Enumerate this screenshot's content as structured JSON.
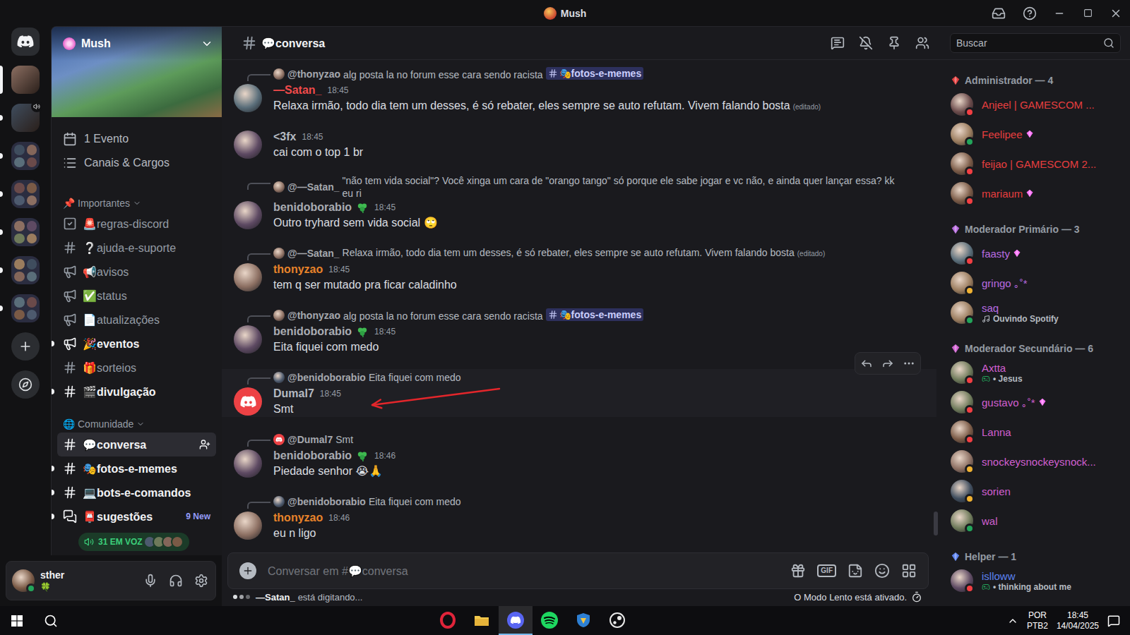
{
  "window": {
    "title": "Mush"
  },
  "servers": [
    {
      "kind": "server",
      "selected": true,
      "unread": false,
      "voice": false
    },
    {
      "kind": "server",
      "selected": false,
      "unread": true,
      "voice": true
    },
    {
      "kind": "folder",
      "selected": false,
      "unread": true,
      "voice": false
    },
    {
      "kind": "folder",
      "selected": false,
      "unread": true,
      "voice": false
    },
    {
      "kind": "folder",
      "selected": false,
      "unread": true,
      "voice": false
    },
    {
      "kind": "folder",
      "selected": false,
      "unread": true,
      "voice": false
    },
    {
      "kind": "folder",
      "selected": false,
      "unread": true,
      "voice": false
    }
  ],
  "server": {
    "name": "Mush",
    "events": "1 Evento",
    "browse": "Canais & Cargos"
  },
  "categories": [
    {
      "emoji": "📌",
      "name": "Importantes",
      "expanded": true,
      "channels": [
        {
          "kind": "rules",
          "name": "🚨regras-discord",
          "selected": false,
          "unread": false,
          "badge": ""
        },
        {
          "kind": "text",
          "name": "❔ajuda-e-suporte",
          "selected": false,
          "unread": false,
          "badge": ""
        },
        {
          "kind": "announcement",
          "name": "📢avisos",
          "selected": false,
          "unread": false,
          "badge": ""
        },
        {
          "kind": "announcement",
          "name": "✅status",
          "selected": false,
          "unread": false,
          "badge": ""
        },
        {
          "kind": "announcement",
          "name": "📄atualizações",
          "selected": false,
          "unread": false,
          "badge": ""
        },
        {
          "kind": "announcement",
          "name": "🎉eventos",
          "selected": false,
          "unread": true,
          "badge": ""
        },
        {
          "kind": "text",
          "name": "🎁sorteios",
          "selected": false,
          "unread": false,
          "badge": ""
        },
        {
          "kind": "text",
          "name": "🎬divulgação",
          "selected": false,
          "unread": true,
          "badge": ""
        }
      ]
    },
    {
      "emoji": "🌐",
      "name": "Comunidade",
      "expanded": true,
      "channels": [
        {
          "kind": "text",
          "name": "💬conversa",
          "selected": true,
          "unread": false,
          "badge": ""
        },
        {
          "kind": "text",
          "name": "🎭fotos-e-memes",
          "selected": false,
          "unread": true,
          "badge": ""
        },
        {
          "kind": "text",
          "name": "💻bots-e-comandos",
          "selected": false,
          "unread": true,
          "badge": ""
        },
        {
          "kind": "forum",
          "name": "📮sugestões",
          "selected": false,
          "unread": true,
          "badge": "9 New"
        }
      ]
    }
  ],
  "voice": {
    "label": "31 EM VOZ",
    "avatars": 4
  },
  "user": {
    "name": "sther",
    "status": "online",
    "custom_status": "🍀"
  },
  "channel": {
    "name": "💬conversa"
  },
  "search": {
    "placeholder": "Buscar"
  },
  "messages": [
    {
      "author": "—Satan_",
      "color": "#f04a4a",
      "avatar": "photo",
      "role_icon": false,
      "time": "18:45",
      "content": "Relaxa irmão, todo dia tem um desses, é só rebater, eles sempre se auto refutam. Vivem falando bosta",
      "edited": "(editado)",
      "hovered": false,
      "marked": false,
      "reply": {
        "author": "@thonyzao",
        "avatar": "photo",
        "text": "alg posta la no forum esse cara sendo racista",
        "mention": "🎭fotos-e-memes",
        "edited": ""
      }
    },
    {
      "author": "<3fx",
      "color": "#b5bac1",
      "avatar": "photo",
      "role_icon": false,
      "time": "18:45",
      "content": "cai com o top 1 br",
      "edited": "",
      "hovered": false,
      "marked": false,
      "reply": null
    },
    {
      "author": "benidoborabio",
      "color": "#a9acb2",
      "avatar": "photo",
      "role_icon": true,
      "time": "18:45",
      "content": "Outro tryhard sem vida social 🙄",
      "edited": "",
      "hovered": false,
      "marked": false,
      "reply": {
        "author": "@—Satan_",
        "avatar": "photo",
        "text": "\"não tem vida social\"? Você xinga um cara de \"orango tango\" só porque ele sabe jogar e vc não, e ainda quer lançar essa? kk eu ri",
        "mention": "",
        "edited": ""
      }
    },
    {
      "author": "thonyzao",
      "color": "#e8832a",
      "avatar": "photo",
      "role_icon": false,
      "time": "18:45",
      "content": "tem q ser mutado pra ficar caladinho",
      "edited": "",
      "hovered": false,
      "marked": false,
      "reply": {
        "author": "@—Satan_",
        "avatar": "photo",
        "text": "Relaxa irmão, todo dia tem um desses, é só rebater, eles sempre se auto refutam. Vivem falando bosta",
        "mention": "",
        "edited": "(editado)"
      }
    },
    {
      "author": "benidoborabio",
      "color": "#a9acb2",
      "avatar": "photo",
      "role_icon": true,
      "time": "18:45",
      "content": "Eita fiquei com medo",
      "edited": "",
      "hovered": false,
      "marked": false,
      "reply": {
        "author": "@thonyzao",
        "avatar": "photo",
        "text": "alg posta la no forum esse cara sendo racista",
        "mention": "🎭fotos-e-memes",
        "edited": ""
      }
    },
    {
      "author": "Dumal7",
      "color": "#b5bac1",
      "avatar": "default",
      "role_icon": false,
      "time": "18:45",
      "content": "Smt",
      "edited": "",
      "hovered": true,
      "marked": true,
      "reply": {
        "author": "@benidoborabio",
        "avatar": "photo",
        "text": "Eita fiquei com medo",
        "mention": "",
        "edited": ""
      }
    },
    {
      "author": "benidoborabio",
      "color": "#a9acb2",
      "avatar": "photo",
      "role_icon": true,
      "time": "18:46",
      "content": "Piedade senhor 😭🙏",
      "edited": "",
      "hovered": false,
      "marked": false,
      "reply": {
        "author": "@Dumal7",
        "avatar": "default",
        "text": "Smt",
        "mention": "",
        "edited": ""
      }
    },
    {
      "author": "thonyzao",
      "color": "#e8832a",
      "avatar": "photo",
      "role_icon": false,
      "time": "18:46",
      "content": "eu n ligo",
      "edited": "",
      "hovered": false,
      "marked": false,
      "reply": {
        "author": "@benidoborabio",
        "avatar": "photo",
        "text": "Eita fiquei com medo",
        "mention": "",
        "edited": ""
      }
    }
  ],
  "composer": {
    "placeholder": "Conversar em #💬conversa",
    "gif": "GIF"
  },
  "typing": {
    "name": "—Satan_",
    "text": "está digitando..."
  },
  "slow_mode": "O Modo Lento está ativado.",
  "member_groups": [
    {
      "name": "Administrador — 4",
      "color": "#e53e3e",
      "members": [
        {
          "name": "Anjeel | GAMESCOM ...",
          "status": "dnd",
          "badge": false,
          "activity": "",
          "activity_kind": ""
        },
        {
          "name": "Feelipee",
          "status": "online",
          "badge": true,
          "activity": "",
          "activity_kind": ""
        },
        {
          "name": "feijao | GAMESCOM 2...",
          "status": "dnd",
          "badge": false,
          "activity": "",
          "activity_kind": ""
        },
        {
          "name": "mariaum",
          "status": "dnd",
          "badge": true,
          "activity": "",
          "activity_kind": ""
        }
      ]
    },
    {
      "name": "Moderador Primário — 3",
      "color": "#b86be0",
      "members": [
        {
          "name": "faasty",
          "status": "dnd",
          "badge": true,
          "activity": "",
          "activity_kind": ""
        },
        {
          "name": "gringo ｡˚*",
          "status": "idle",
          "badge": false,
          "activity": "",
          "activity_kind": ""
        },
        {
          "name": "saq",
          "status": "online",
          "badge": false,
          "activity": "Ouvindo Spotify",
          "activity_kind": "listening"
        }
      ]
    },
    {
      "name": "Moderador Secundário — 6",
      "color": "#d05fd0",
      "members": [
        {
          "name": "Axtta",
          "status": "dnd",
          "badge": false,
          "activity": "• Jesus",
          "activity_kind": "playing"
        },
        {
          "name": "gustavo ｡˚*",
          "status": "dnd",
          "badge": true,
          "activity": "",
          "activity_kind": ""
        },
        {
          "name": "Lanna",
          "status": "dnd",
          "badge": false,
          "activity": "",
          "activity_kind": ""
        },
        {
          "name": "snockeysnockeysnock...",
          "status": "idle",
          "badge": false,
          "activity": "",
          "activity_kind": ""
        },
        {
          "name": "sorien",
          "status": "idle",
          "badge": false,
          "activity": "",
          "activity_kind": ""
        },
        {
          "name": "wal",
          "status": "online",
          "badge": false,
          "activity": "",
          "activity_kind": ""
        }
      ]
    },
    {
      "name": "Helper — 1",
      "color": "#5b82f0",
      "members": [
        {
          "name": "islloww",
          "status": "dnd",
          "badge": false,
          "activity": "• thinking about me",
          "activity_kind": "playing"
        }
      ]
    }
  ],
  "taskbar": {
    "apps": [
      {
        "kind": "opera",
        "active": false
      },
      {
        "kind": "files",
        "active": false
      },
      {
        "kind": "discord",
        "active": true
      },
      {
        "kind": "spotify",
        "active": false
      },
      {
        "kind": "shield",
        "active": false
      },
      {
        "kind": "steam",
        "active": false
      }
    ],
    "language": {
      "lang": "POR",
      "layout": "PTB2"
    },
    "clock": {
      "time": "18:45",
      "date": "14/04/2025"
    }
  }
}
